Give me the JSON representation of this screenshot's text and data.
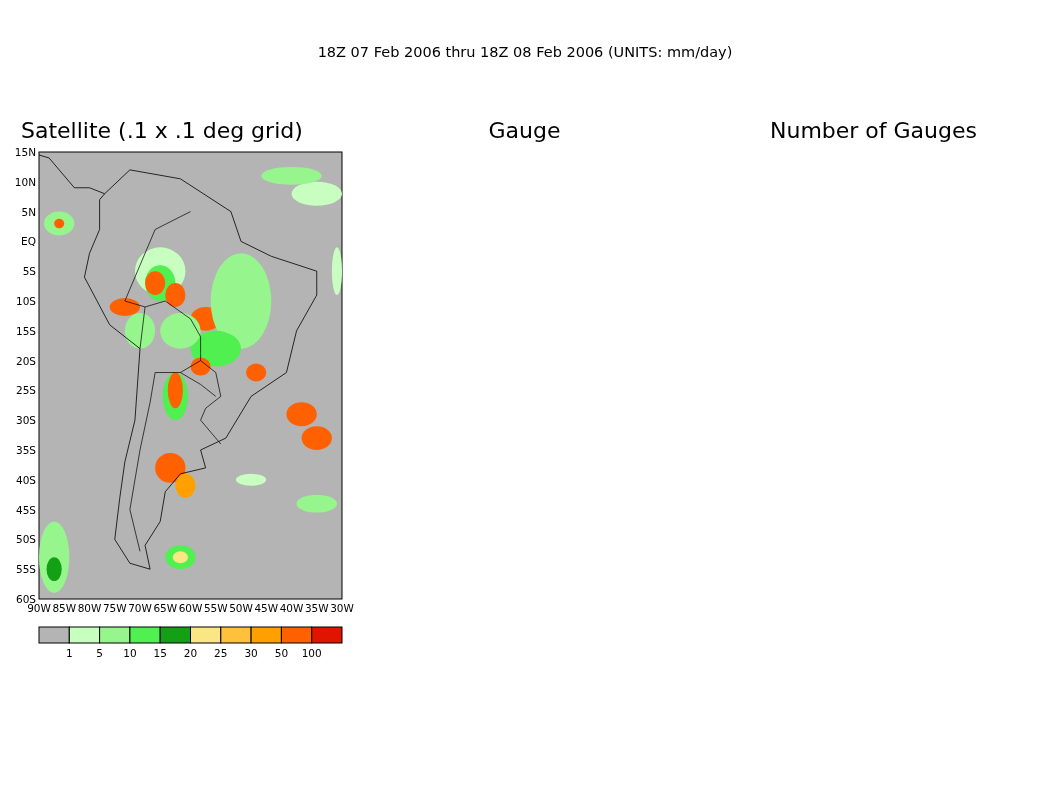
{
  "title": "18Z 07 Feb 2006 thru 18Z 08 Feb 2006 (UNITS: mm/day)",
  "panels": [
    {
      "kind": "map",
      "title": "Satellite (.1 x .1 deg grid)",
      "yticks": [
        "15N",
        "10N",
        "5N",
        "EQ",
        "5S",
        "10S",
        "15S",
        "20S",
        "25S",
        "30S",
        "35S",
        "40S",
        "45S",
        "50S",
        "55S",
        "60S"
      ],
      "xticks": [
        "90W",
        "85W",
        "80W",
        "75W",
        "70W",
        "65W",
        "60W",
        "55W",
        "50W",
        "45W",
        "40W",
        "35W",
        "30W"
      ],
      "colorbar": {
        "bins": [
          {
            "color": "#b4b4b4"
          },
          {
            "color": "#c8ffc0"
          },
          {
            "color": "#96f58c"
          },
          {
            "color": "#50f050"
          },
          {
            "color": "#14a014"
          },
          {
            "color": "#fae682"
          },
          {
            "color": "#ffc03c"
          },
          {
            "color": "#ffa000"
          },
          {
            "color": "#ff6000"
          },
          {
            "color": "#e11400"
          }
        ],
        "labels": [
          "1",
          "5",
          "10",
          "15",
          "20",
          "25",
          "30",
          "50",
          "100"
        ]
      }
    },
    {
      "kind": "empty",
      "title": "Gauge"
    },
    {
      "kind": "empty",
      "title": "Number of Gauges"
    }
  ]
}
